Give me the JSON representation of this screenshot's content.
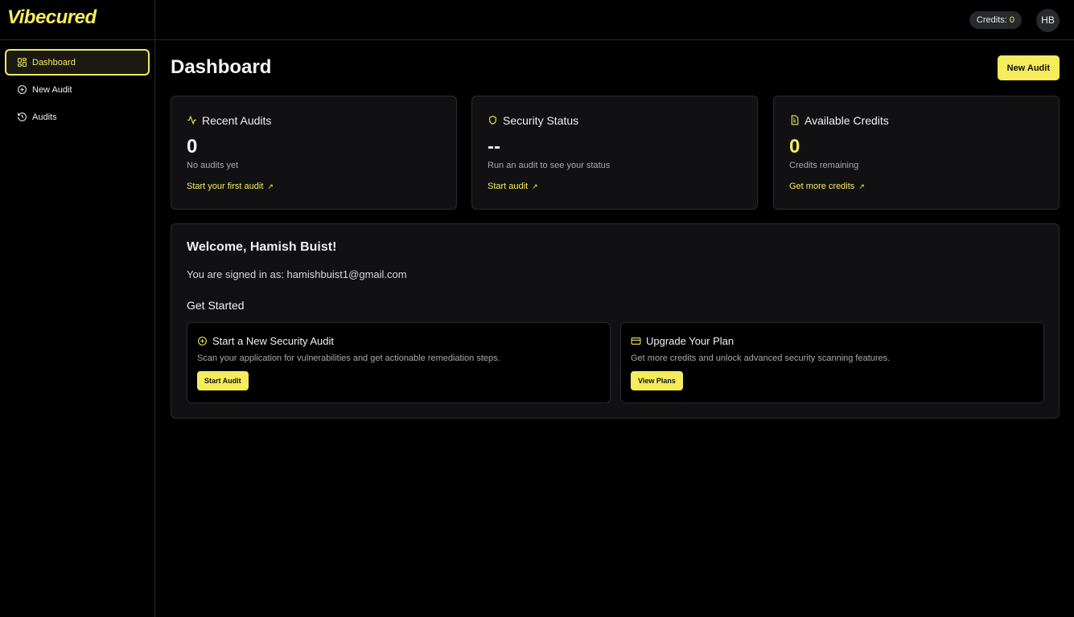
{
  "brand": {
    "logo_text": "Vibecured",
    "accent": "#f5ec5c"
  },
  "sidebar": {
    "items": [
      {
        "label": "Dashboard",
        "icon": "grid-icon",
        "active": true
      },
      {
        "label": "New Audit",
        "icon": "plus-circle-icon",
        "active": false
      },
      {
        "label": "Audits",
        "icon": "history-icon",
        "active": false
      }
    ]
  },
  "topbar": {
    "credits_label": "Credits:",
    "credits_value": "0",
    "avatar_initials": "HB"
  },
  "main": {
    "title": "Dashboard",
    "new_audit_label": "New Audit",
    "cards": [
      {
        "title": "Recent Audits",
        "icon": "activity-icon",
        "value": "0",
        "subtitle": "No audits yet",
        "link": "Start your first audit"
      },
      {
        "title": "Security Status",
        "icon": "shield-icon",
        "value": "--",
        "subtitle": "Run an audit to see your status",
        "link": "Start audit"
      },
      {
        "title": "Available Credits",
        "icon": "document-icon",
        "value": "0",
        "subtitle": "Credits remaining",
        "link": "Get more credits"
      }
    ],
    "welcome": {
      "title": "Welcome, Hamish Buist!",
      "signed_in": "You are signed in as: hamishbuist1@gmail.com",
      "get_started": "Get Started",
      "options": [
        {
          "title": "Start a New Security Audit",
          "icon": "plus-circle-icon",
          "description": "Scan your application for vulnerabilities and get actionable remediation steps.",
          "button": "Start Audit"
        },
        {
          "title": "Upgrade Your Plan",
          "icon": "credit-card-icon",
          "description": "Get more credits and unlock advanced security scanning features.",
          "button": "View Plans"
        }
      ]
    }
  }
}
